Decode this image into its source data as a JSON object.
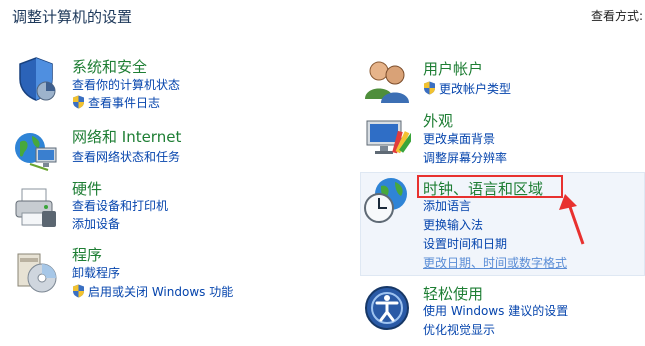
{
  "header": {
    "title": "调整计算机的设置",
    "view_by": "查看方式:"
  },
  "categories": {
    "system": {
      "title": "系统和安全",
      "links": [
        "查看你的计算机状态",
        "查看事件日志"
      ]
    },
    "network": {
      "title": "网络和 Internet",
      "links": [
        "查看网络状态和任务"
      ]
    },
    "hardware": {
      "title": "硬件",
      "links": [
        "查看设备和打印机",
        "添加设备"
      ]
    },
    "programs": {
      "title": "程序",
      "links": [
        "卸载程序",
        "启用或关闭 Windows 功能"
      ]
    },
    "user": {
      "title": "用户帐户",
      "links": [
        "更改帐户类型"
      ]
    },
    "appearance": {
      "title": "外观",
      "links": [
        "更改桌面背景",
        "调整屏幕分辨率"
      ]
    },
    "clock": {
      "title": "时钟、语言和区域",
      "links": [
        "添加语言",
        "更换输入法",
        "设置时间和日期",
        "更改日期、时间或数字格式"
      ]
    },
    "ease": {
      "title": "轻松使用",
      "links": [
        "使用 Windows 建议的设置",
        "优化视觉显示"
      ]
    }
  },
  "colors": {
    "title_green": "#1e7e34",
    "link_blue": "#0645ad",
    "highlight_red": "#e8312f"
  },
  "icons": [
    "shield-security-icon",
    "network-globe-icon",
    "printer-icon",
    "programs-disk-icon",
    "users-icon",
    "appearance-monitor-icon",
    "clock-globe-icon",
    "ease-of-access-icon",
    "uac-shield-icon"
  ]
}
